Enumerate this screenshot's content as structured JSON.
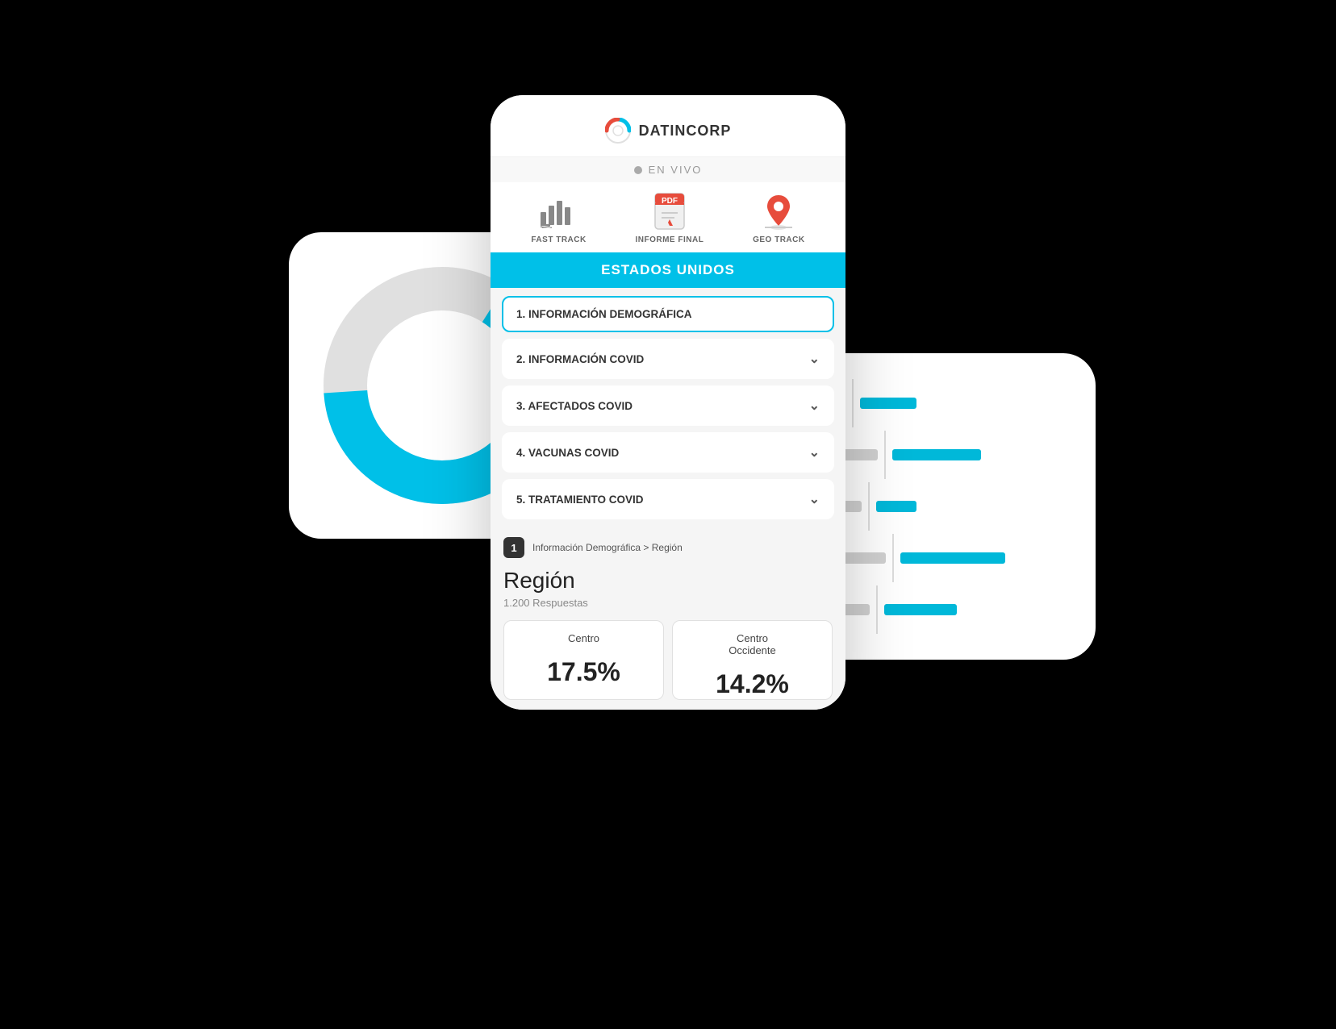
{
  "background": "#000000",
  "logo": {
    "text": "DATINCORP"
  },
  "live": {
    "label": "EN VIVO"
  },
  "nav": {
    "items": [
      {
        "id": "fast-track",
        "label": "FAST TRACK"
      },
      {
        "id": "informe-final",
        "label": "INFORME FINAL"
      },
      {
        "id": "geo-track",
        "label": "GEO TRACK"
      }
    ]
  },
  "section_header": "ESTADOS UNIDOS",
  "accordion": {
    "items": [
      {
        "number": "1",
        "label": "INFORMACIÓN DEMOGRÁFICA",
        "active": true
      },
      {
        "number": "2",
        "label": "INFORMACIÓN COVID",
        "active": false
      },
      {
        "number": "3",
        "label": "AFECTADOS COVID",
        "active": false
      },
      {
        "number": "4",
        "label": "VACUNAS COVID",
        "active": false
      },
      {
        "number": "5",
        "label": "TRATAMIENTO COVID",
        "active": false
      }
    ]
  },
  "breadcrumb": {
    "number": "1",
    "path": "Información Demográfica  >  Región"
  },
  "region": {
    "title": "Región",
    "subtitle": "1.200 Respuestas",
    "cards": [
      {
        "label": "Centro",
        "value": "17.5%"
      },
      {
        "label": "Centro\nOccidente",
        "value": "14.2%"
      }
    ]
  },
  "donut": {
    "cyan_percent": 65,
    "gray_percent": 35
  },
  "bar_chart": {
    "rows": [
      {
        "gray": 40,
        "cyan": 70
      },
      {
        "gray": 80,
        "cyan": 110
      },
      {
        "gray": 60,
        "cyan": 50
      },
      {
        "gray": 90,
        "cyan": 130
      },
      {
        "gray": 70,
        "cyan": 90
      }
    ]
  }
}
